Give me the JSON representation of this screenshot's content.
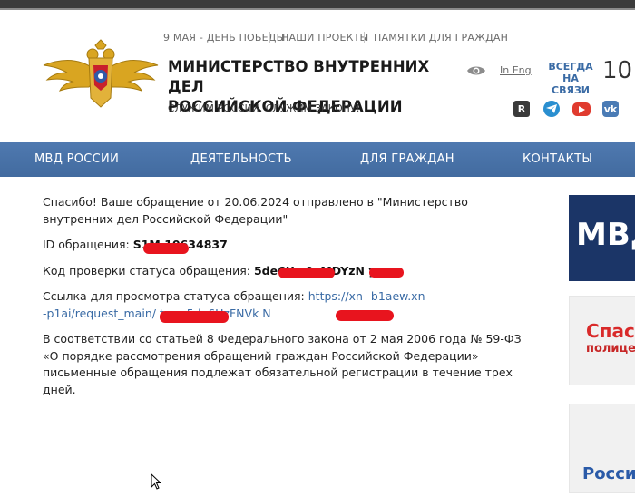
{
  "top_links": [
    "9 МАЯ - ДЕНЬ ПОБЕДЫ",
    "НАШИ ПРОЕКТЫ",
    "ПАМЯТКИ ДЛЯ ГРАЖДАН"
  ],
  "site": {
    "title_line1": "МИНИСТЕРСТВО ВНУТРЕННИХ ДЕЛ",
    "title_line2": "РОССИЙСКОЙ ФЕДЕРАЦИИ",
    "slogan": "СЛУЖИМ РОССИИ, СЛУЖИМ ЗАКОНУ!"
  },
  "header_right": {
    "lang": "In Eng",
    "always_line1": "ВСЕГДА",
    "always_line2": "НА СВЯЗИ",
    "phone": "10",
    "social_icons": [
      "rutube-icon",
      "telegram-icon",
      "youtube-icon",
      "vk-icon"
    ]
  },
  "main_nav": [
    "МВД РОССИИ",
    "ДЕЯТЕЛЬНОСТЬ",
    "ДЛЯ ГРАЖДАН",
    "КОНТАКТЫ"
  ],
  "message": {
    "thanks": "Спасибо! Ваше обращение от 20.06.2024 отправлено в \"Министерство внутренних дел Российской Федерации\"",
    "id_label": "ID обращения:",
    "id_value": "S1M      10634837",
    "code_label": "Код проверки статуса обращения:",
    "code_value": "5de6Uz          0xMDYzN      y",
    "link_label": "Ссылка для просмотра статуса обращения:",
    "link_value": "https://xn--b1aew.xn--p1ai/request_main/           tus=5de6UzFNVk         N",
    "law_text": "В соответствии со статьей 8 Федерального закона от 2 мая 2006 года № 59-ФЗ «О порядке рассмотрения обращений граждан Российской Федерации» письменные обращения подлежат обязательной регистрации в течение трех дней."
  },
  "banners": {
    "b1": "МВД",
    "b2_line1": "Спас",
    "b2_line2": "полице",
    "b3": "Росси"
  },
  "colors": {
    "nav_blue": "#4a74aa",
    "link_blue": "#3a6ba5",
    "redaction": "#e8141e"
  }
}
